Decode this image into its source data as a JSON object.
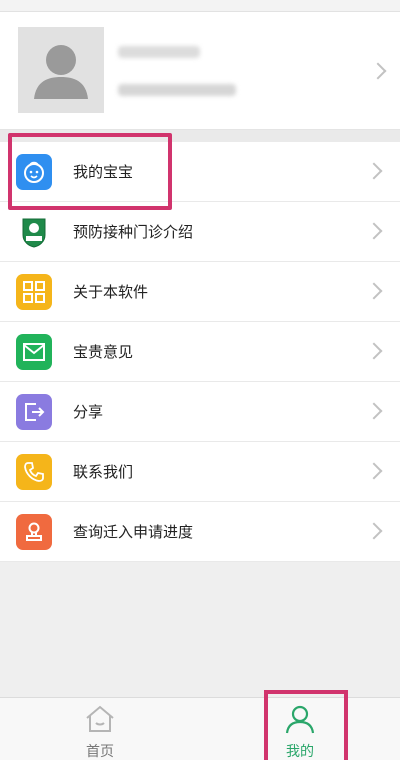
{
  "profile": {
    "name_blurred": "",
    "subtitle_blurred": ""
  },
  "menu": {
    "items": [
      {
        "label": "我的宝宝",
        "icon": "baby-face-icon",
        "color": "#2f8ff0"
      },
      {
        "label": "预防接种门诊介绍",
        "icon": "clinic-logo-icon",
        "color": "#1f8a4a"
      },
      {
        "label": "关于本软件",
        "icon": "grid-icon",
        "color": "#f5b51a"
      },
      {
        "label": "宝贵意见",
        "icon": "mail-icon",
        "color": "#21b35a"
      },
      {
        "label": "分享",
        "icon": "share-icon",
        "color": "#8a7be0"
      },
      {
        "label": "联系我们",
        "icon": "phone-icon",
        "color": "#f5b51a"
      },
      {
        "label": "查询迁入申请进度",
        "icon": "person-stamp-icon",
        "color": "#f06a3f"
      }
    ]
  },
  "tabbar": {
    "home_label": "首页",
    "mine_label": "我的",
    "active": "mine",
    "accent": "#2aa66a",
    "highlight": "#d1346d"
  }
}
